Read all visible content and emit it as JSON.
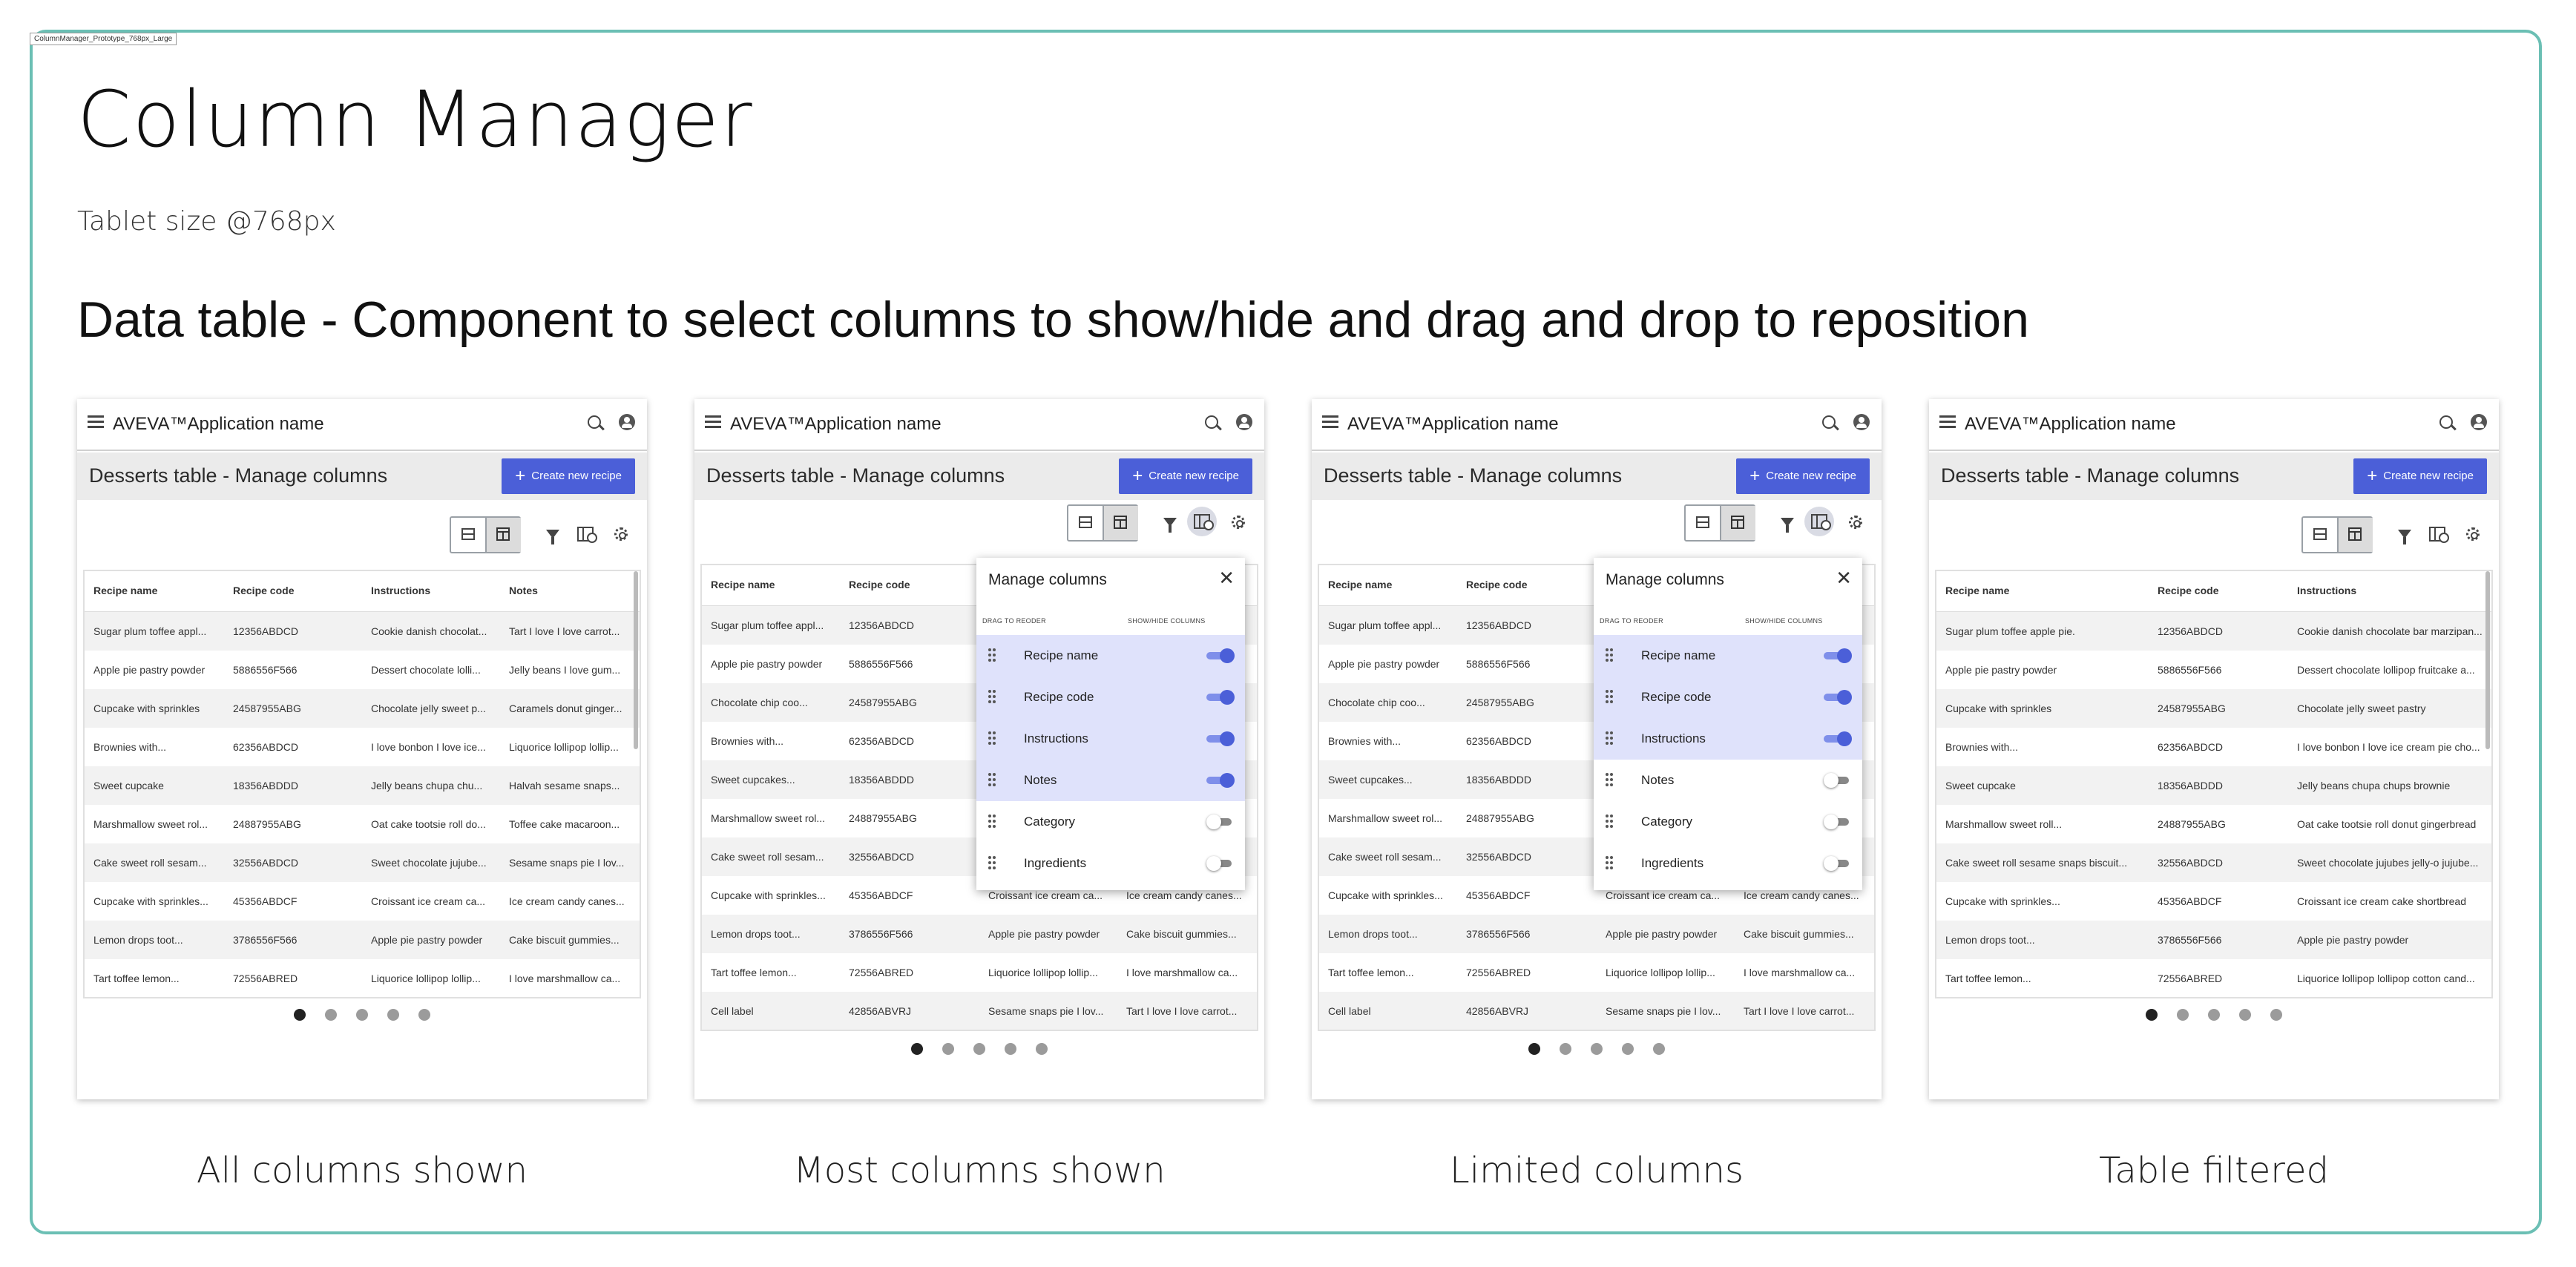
{
  "frame_label": "ColumnManager_Prototype_768px_Large",
  "title": "Column Manager",
  "subtitle": "Tablet size @768px",
  "heading": "Data table - Component to select columns to show/hide and drag and drop to reposition",
  "captions": [
    "All columns shown",
    "Most columns shown",
    "Limited columns",
    "Table filtered"
  ],
  "app": {
    "brand": "AVEVA™Application name",
    "page_title": "Desserts table - Manage columns",
    "create_button": "Create new recipe",
    "icons": [
      "menu-icon",
      "search-icon",
      "account-icon",
      "rows-view-icon",
      "table-view-icon",
      "filter-icon",
      "columns-icon",
      "settings-icon"
    ]
  },
  "popup": {
    "title": "Manage columns",
    "drag_label": "DRAG TO REODER",
    "show_label": "SHOW/HIDE COLUMNS"
  },
  "panels": [
    {
      "headers": [
        "Recipe name",
        "Recipe code",
        "Instructions",
        "Notes"
      ],
      "rows": [
        [
          "Sugar plum toffee appl...",
          "12356ABDCD",
          "Cookie danish chocolat...",
          "Tart I love I love carrot..."
        ],
        [
          "Apple pie pastry powder",
          "5886556F566",
          "Dessert chocolate lolli...",
          "Jelly beans I love gum..."
        ],
        [
          "Cupcake with sprinkles",
          "24587955ABG",
          "Chocolate jelly sweet p...",
          "Caramels donut ginger..."
        ],
        [
          "Brownies with...",
          "62356ABDCD",
          "I love bonbon I love ice...",
          "Liquorice lollipop lollip..."
        ],
        [
          "Sweet cupcake",
          "18356ABDDD",
          "Jelly beans chupa chu...",
          "Halvah sesame snaps..."
        ],
        [
          "Marshmallow sweet rol...",
          "24887955ABG",
          "Oat cake tootsie roll do...",
          "Toffee cake macaroon..."
        ],
        [
          "Cake sweet roll sesam...",
          "32556ABDCD",
          "Sweet chocolate jujube...",
          "Sesame snaps pie I lov..."
        ],
        [
          "Cupcake with sprinkles...",
          "45356ABDCF",
          "Croissant ice cream ca...",
          "Ice cream candy canes..."
        ],
        [
          "Lemon drops toot...",
          "3786556F566",
          "Apple pie pastry powder",
          "Cake biscuit gummies..."
        ],
        [
          "Tart toffee lemon...",
          "72556ABRED",
          "Liquorice lollipop lollip...",
          " I love marshmallow ca..."
        ]
      ]
    },
    {
      "headers": [
        "Recipe name",
        "Recipe code",
        "Instructions",
        "Notes"
      ],
      "rows": [
        [
          "Sugar plum toffee appl...",
          "12356ABDCD",
          "",
          ""
        ],
        [
          "Apple pie pastry powder",
          "5886556F566",
          "",
          ""
        ],
        [
          "Chocolate chip coo...",
          "24587955ABG",
          "",
          ""
        ],
        [
          "Brownies with...",
          "62356ABDCD",
          "",
          ""
        ],
        [
          "Sweet cupcakes...",
          "18356ABDDD",
          "",
          ""
        ],
        [
          "Marshmallow sweet rol...",
          "24887955ABG",
          "",
          ""
        ],
        [
          "Cake sweet roll sesam...",
          "32556ABDCD",
          "",
          ""
        ],
        [
          "Cupcake with sprinkles...",
          "45356ABDCF",
          "Croissant ice cream ca...",
          "Ice cream candy canes..."
        ],
        [
          "Lemon drops toot...",
          "3786556F566",
          "Apple pie pastry powder",
          "Cake biscuit gummies..."
        ],
        [
          "Tart toffee lemon...",
          "72556ABRED",
          "Liquorice lollipop lollip...",
          " I love marshmallow ca..."
        ],
        [
          "Cell label",
          "42856ABVRJ",
          "Sesame snaps pie I lov...",
          "Tart I love I love carrot..."
        ]
      ],
      "columns": [
        {
          "name": "Recipe name",
          "shown": true
        },
        {
          "name": "Recipe code",
          "shown": true
        },
        {
          "name": "Instructions",
          "shown": true
        },
        {
          "name": "Notes",
          "shown": true
        },
        {
          "name": "Category",
          "shown": false
        },
        {
          "name": "Ingredients",
          "shown": false
        }
      ]
    },
    {
      "headers": [
        "Recipe name",
        "Recipe code",
        "Instructions",
        "Notes"
      ],
      "rows": [
        [
          "Sugar plum toffee appl...",
          "12356ABDCD",
          "",
          ""
        ],
        [
          "Apple pie pastry powder",
          "5886556F566",
          "",
          ""
        ],
        [
          "Chocolate chip coo...",
          "24587955ABG",
          "",
          ""
        ],
        [
          "Brownies with...",
          "62356ABDCD",
          "",
          ""
        ],
        [
          "Sweet cupcakes...",
          "18356ABDDD",
          "",
          ""
        ],
        [
          "Marshmallow sweet rol...",
          "24887955ABG",
          "",
          ""
        ],
        [
          "Cake sweet roll sesam...",
          "32556ABDCD",
          "",
          ""
        ],
        [
          "Cupcake with sprinkles...",
          "45356ABDCF",
          "Croissant ice cream ca...",
          "Ice cream candy canes..."
        ],
        [
          "Lemon drops toot...",
          "3786556F566",
          "Apple pie pastry powder",
          "Cake biscuit gummies..."
        ],
        [
          "Tart toffee lemon...",
          "72556ABRED",
          "Liquorice lollipop lollip...",
          " I love marshmallow ca..."
        ],
        [
          "Cell label",
          "42856ABVRJ",
          "Sesame snaps pie I lov...",
          "Tart I love I love carrot..."
        ]
      ],
      "columns": [
        {
          "name": "Recipe name",
          "shown": true
        },
        {
          "name": "Recipe code",
          "shown": true
        },
        {
          "name": "Instructions",
          "shown": true
        },
        {
          "name": "Notes",
          "shown": false
        },
        {
          "name": "Category",
          "shown": false
        },
        {
          "name": "Ingredients",
          "shown": false
        }
      ]
    },
    {
      "headers": [
        "Recipe name",
        "Recipe code",
        "Instructions"
      ],
      "rows": [
        [
          "Sugar plum toffee apple pie.",
          "12356ABDCD",
          "Cookie danish chocolate bar marzipan..."
        ],
        [
          "Apple pie pastry powder",
          "5886556F566",
          "Dessert chocolate lollipop fruitcake a..."
        ],
        [
          "Cupcake with sprinkles",
          "24587955ABG",
          "Chocolate jelly sweet pastry"
        ],
        [
          "Brownies with...",
          "62356ABDCD",
          "I love bonbon I love ice cream pie cho..."
        ],
        [
          "Sweet cupcake",
          "18356ABDDD",
          "Jelly beans chupa chups brownie"
        ],
        [
          "Marshmallow sweet roll...",
          "24887955ABG",
          "Oat cake tootsie roll donut gingerbread"
        ],
        [
          "Cake sweet roll sesame snaps biscuit...",
          "32556ABDCD",
          "Sweet chocolate jujubes jelly-o jujube..."
        ],
        [
          "Cupcake with sprinkles...",
          "45356ABDCF",
          "Croissant ice cream cake shortbread"
        ],
        [
          "Lemon drops toot...",
          "3786556F566",
          "Apple pie pastry powder"
        ],
        [
          "Tart toffee lemon...",
          "72556ABRED",
          "Liquorice lollipop lollipop cotton cand..."
        ]
      ]
    }
  ],
  "pagination": {
    "pages": 5,
    "current": 1
  }
}
